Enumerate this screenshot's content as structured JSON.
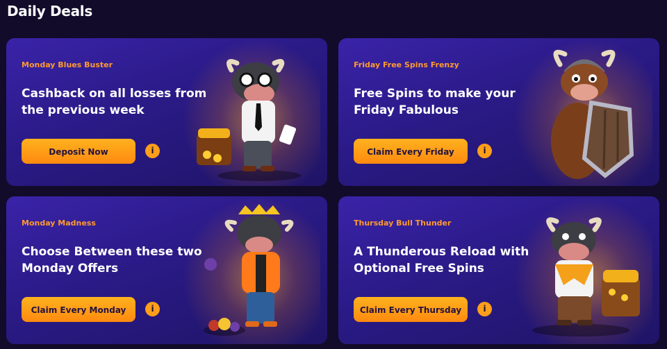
{
  "page": {
    "title": "Daily Deals"
  },
  "cards": [
    {
      "subtitle": "Monday Blues Buster",
      "headline": "Cashback on all losses from the previous week",
      "button": "Deposit Now",
      "info": "i",
      "mascot": "bull-businessman-icon"
    },
    {
      "subtitle": "Friday Free Spins Frenzy",
      "headline": "Free Spins to make your Friday Fabulous",
      "button": "Claim Every Friday",
      "info": "i",
      "mascot": "bull-viking-shield-icon"
    },
    {
      "subtitle": "Monday Madness",
      "headline": "Choose Between these two Monday Offers",
      "button": "Claim Every Monday",
      "info": "i",
      "mascot": "bull-king-fruits-icon"
    },
    {
      "subtitle": "Thursday Bull Thunder",
      "headline": "A Thunderous Reload with Optional Free Spins",
      "button": "Claim Every Thursday",
      "info": "i",
      "mascot": "bull-treasure-chest-icon"
    }
  ],
  "colors": {
    "accent": "#ff9a2e",
    "button": "#ffa51a",
    "card": "#2f1d94",
    "background": "#120b2a"
  }
}
